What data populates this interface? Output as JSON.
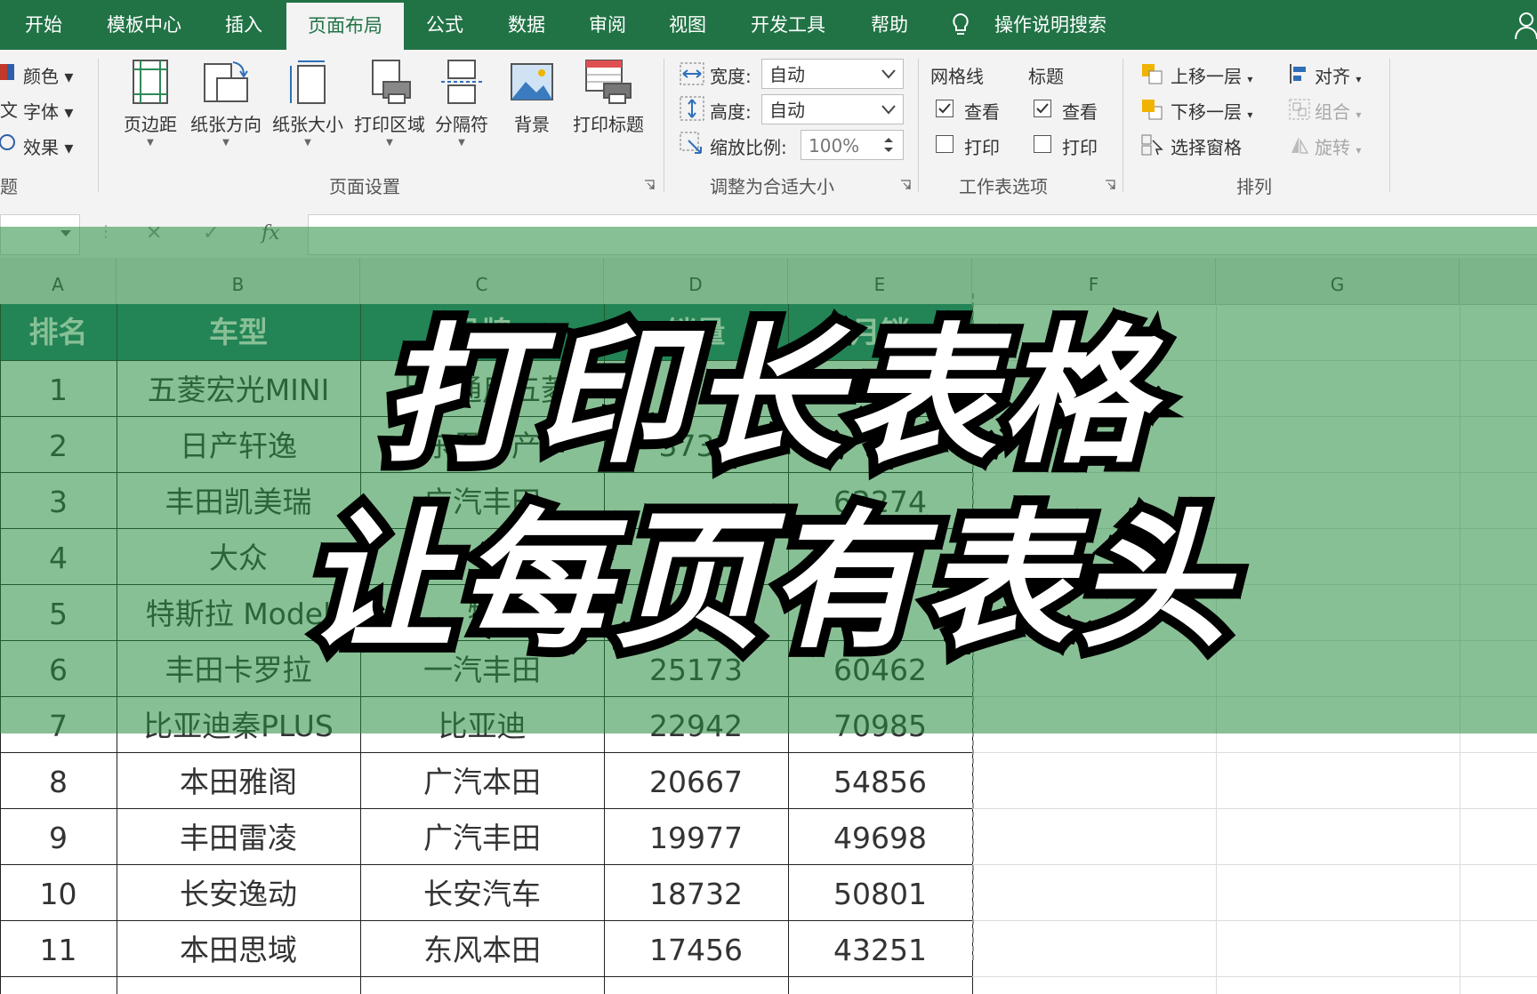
{
  "tabs": [
    "开始",
    "模板中心",
    "插入",
    "页面布局",
    "公式",
    "数据",
    "审阅",
    "视图",
    "开发工具",
    "帮助"
  ],
  "active_tab": "页面布局",
  "tell_me": "操作说明搜索",
  "theme_group": {
    "items": [
      "颜色",
      "字体",
      "效果"
    ],
    "label_partial": "题"
  },
  "page_setup": {
    "buttons": [
      "页边距",
      "纸张方向",
      "纸张大小",
      "打印区域",
      "分隔符",
      "背景",
      "打印标题"
    ],
    "label": "页面设置"
  },
  "scale_to_fit": {
    "width_label": "宽度:",
    "width_value": "自动",
    "height_label": "高度:",
    "height_value": "自动",
    "scale_label": "缩放比例:",
    "scale_value": "100%",
    "label": "调整为合适大小"
  },
  "sheet_options": {
    "gridlines": "网格线",
    "headings": "标题",
    "view": "查看",
    "print": "打印",
    "gridlines_view": true,
    "gridlines_print": false,
    "headings_view": true,
    "headings_print": false,
    "label": "工作表选项"
  },
  "arrange": {
    "bring_forward": "上移一层",
    "send_backward": "下移一层",
    "selection_pane": "选择窗格",
    "align": "对齐",
    "group": "组合",
    "rotate": "旋转",
    "label": "排列"
  },
  "formula_bar": {
    "cancel": "✕",
    "enter": "✓",
    "fx": "fx"
  },
  "columns": [
    "A",
    "B",
    "C",
    "D",
    "E",
    "F",
    "G"
  ],
  "table": {
    "headers": [
      "排名",
      "车型",
      "品牌",
      "销量",
      "月销"
    ],
    "rows": [
      [
        "1",
        "五菱宏光MINI",
        "上汽通用五菱",
        "",
        ""
      ],
      [
        "2",
        "日产轩逸",
        "东风日产",
        "3733",
        "6"
      ],
      [
        "3",
        "丰田凯美瑞",
        "广汽丰田",
        "",
        "62274"
      ],
      [
        "4",
        "大众",
        "",
        "",
        ""
      ],
      [
        "5",
        "特斯拉 Model",
        "特",
        "",
        ""
      ],
      [
        "6",
        "丰田卡罗拉",
        "一汽丰田",
        "25173",
        "60462"
      ],
      [
        "7",
        "比亚迪秦PLUS",
        "比亚迪",
        "22942",
        "70985"
      ],
      [
        "8",
        "本田雅阁",
        "广汽本田",
        "20667",
        "54856"
      ],
      [
        "9",
        "丰田雷凌",
        "广汽丰田",
        "19977",
        "49698"
      ],
      [
        "10",
        "长安逸动",
        "长安汽车",
        "18732",
        "50801"
      ],
      [
        "11",
        "本田思域",
        "东风本田",
        "17456",
        "43251"
      ]
    ]
  },
  "overlay_title": {
    "line1": "打印长表格",
    "line2": "让每页有表头"
  },
  "colors": {
    "excel_green": "#217346",
    "header_teal": "#1f7a74",
    "overlay": "#268c3e"
  }
}
